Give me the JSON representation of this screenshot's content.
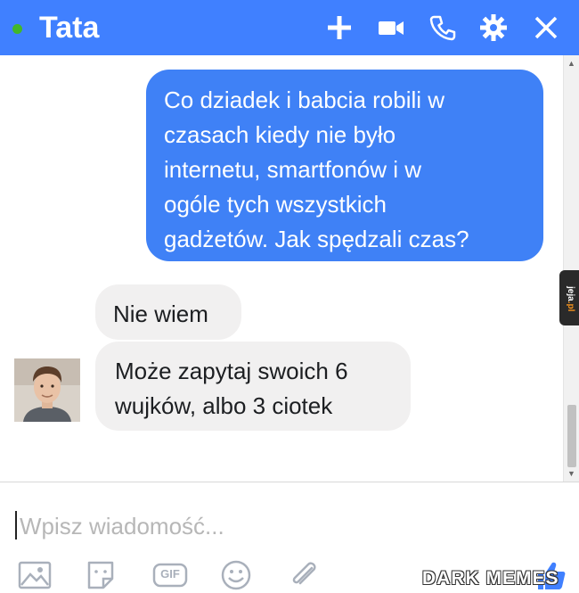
{
  "header": {
    "contact_name": "Tata",
    "online": true,
    "icons": [
      "plus-icon",
      "video-camera-icon",
      "phone-icon",
      "gear-icon",
      "close-icon"
    ]
  },
  "conversation": {
    "messages": [
      {
        "direction": "outgoing",
        "lines": [
          "Co dziadek i babcia robili w",
          "czasach kiedy nie było",
          "internetu, smartfonów i w",
          "ogóle tych wszystkich",
          "gadżetów. Jak spędzali czas?"
        ]
      },
      {
        "direction": "incoming",
        "lines": [
          "Nie wiem"
        ]
      },
      {
        "direction": "incoming",
        "lines": [
          "Może zapytaj swoich 6",
          "wujków, albo 3 ciotek"
        ]
      }
    ]
  },
  "side_tab": {
    "text_main": "jeja",
    "text_accent": ".pl"
  },
  "composer": {
    "placeholder": "Wpisz wiadomość...",
    "value": "",
    "gif_label": "GIF",
    "icons": [
      "image-icon",
      "sticker-icon",
      "gif-icon",
      "emoji-icon",
      "attachment-icon",
      "thumbs-up-icon"
    ]
  },
  "watermark": {
    "text": "DARK MEMES"
  },
  "colors": {
    "header_bg": "#4080ff",
    "online": "#42b72a",
    "outgoing_bubble": "#3f81f6",
    "incoming_bubble": "#f1f0f0"
  }
}
